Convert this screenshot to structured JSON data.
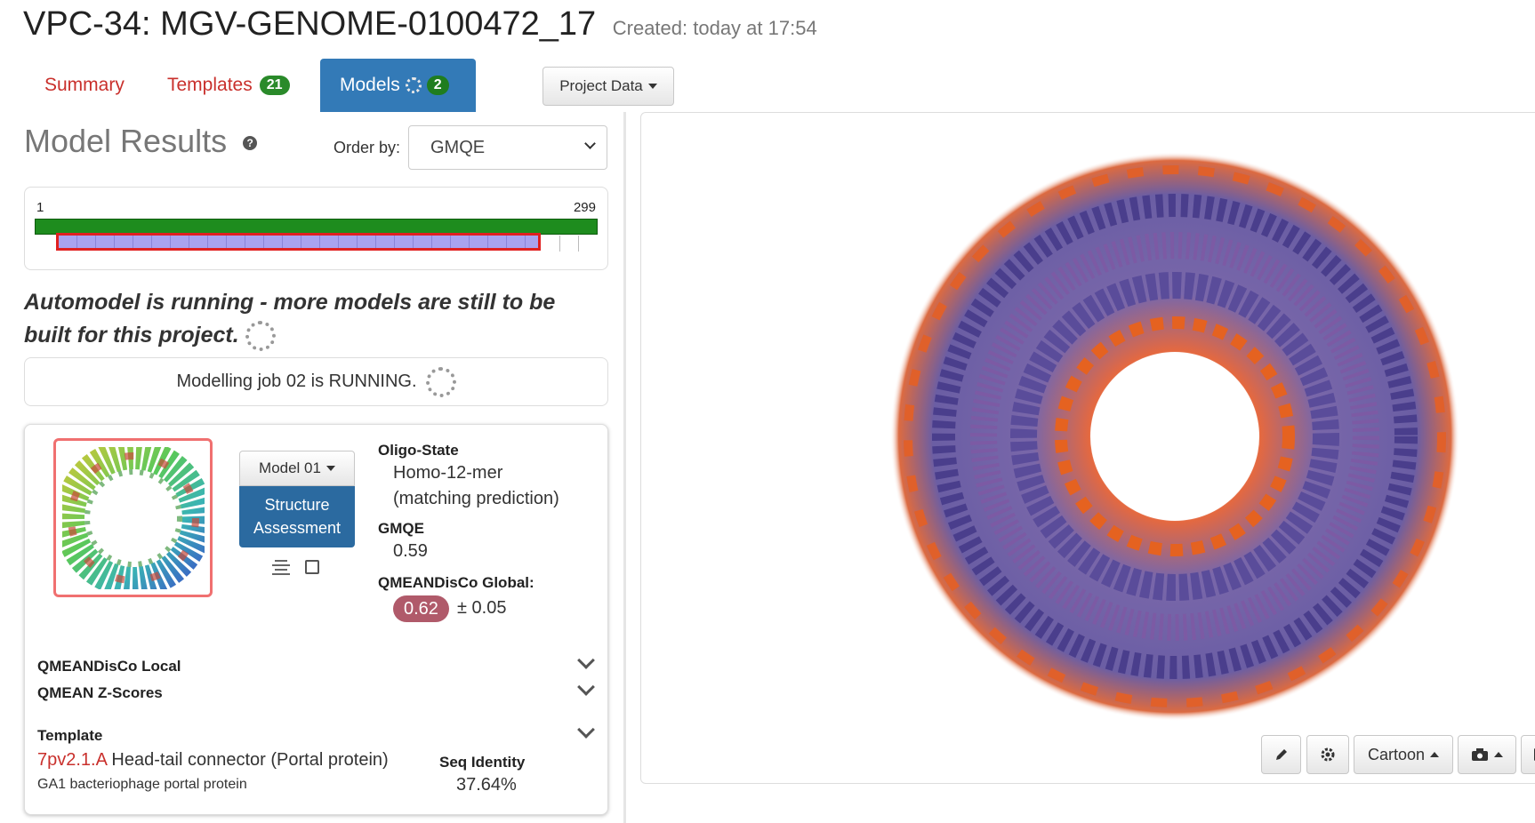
{
  "header": {
    "title": "VPC-34: MGV-GENOME-0100472_17",
    "created": "Created: today at 17:54"
  },
  "tabs": [
    {
      "label": "Summary"
    },
    {
      "label": "Templates",
      "badge": "21"
    },
    {
      "label": "Models",
      "badge": "2"
    }
  ],
  "project_data_label": "Project Data",
  "results": {
    "title": "Model Results",
    "order_by_label": "Order by:",
    "order_by_value": "GMQE"
  },
  "alignment": {
    "start": "1",
    "end": "299"
  },
  "automodel": {
    "message": "Automodel is running - more models are still to be built for this project.",
    "job_status": "Modelling job 02 is RUNNING."
  },
  "model": {
    "select_label": "Model 01",
    "assessment_label": "Structure Assessment",
    "oligo_state_label": "Oligo-State",
    "oligo_state_value": "Homo-12-mer",
    "oligo_state_note": "(matching prediction)",
    "gmqe_label": "GMQE",
    "gmqe_value": "0.59",
    "qmean_global_label": "QMEANDisCo Global:",
    "qmean_global_value": "0.62",
    "qmean_global_error": "± 0.05",
    "qmean_local_label": "QMEANDisCo Local",
    "qmean_z_label": "QMEAN Z-Scores",
    "template_label": "Template",
    "template_id": "7pv2.1.A",
    "template_name": "Head-tail connector (Portal protein)",
    "template_desc": "GA1 bacteriophage portal protein",
    "seq_identity_label": "Seq Identity",
    "seq_identity_value": "37.64%"
  },
  "viewer": {
    "style_label": "Cartoon"
  },
  "colors": {
    "accent_blue": "#337ab7",
    "link_red": "#c9302c",
    "badge_green": "#2a8a2a",
    "qmean_badge": "#b05a6a",
    "coverage_green": "#1e8c1e",
    "model_bar": "#a9a3f0"
  },
  "icons": {
    "pencil": "pencil-icon",
    "gear": "gear-icon",
    "camera": "camera-icon"
  }
}
